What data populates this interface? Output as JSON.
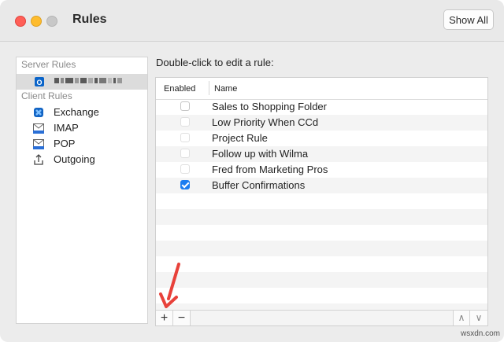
{
  "window": {
    "title": "Rules",
    "show_all_label": "Show All"
  },
  "sidebar": {
    "server_header": "Server Rules",
    "client_header": "Client Rules",
    "client_items": [
      {
        "label": "Exchange",
        "icon": "exchange-icon"
      },
      {
        "label": "IMAP",
        "icon": "imap-icon"
      },
      {
        "label": "POP",
        "icon": "pop-icon"
      },
      {
        "label": "Outgoing",
        "icon": "outgoing-icon"
      }
    ]
  },
  "main": {
    "prompt": "Double-click to edit a rule:",
    "columns": {
      "enabled": "Enabled",
      "name": "Name"
    },
    "rules": [
      {
        "name": "Sales to Shopping Folder",
        "enabled": false
      },
      {
        "name": "Low Priority When CCd",
        "enabled": false
      },
      {
        "name": "Project Rule",
        "enabled": false
      },
      {
        "name": "Follow up with Wilma",
        "enabled": false
      },
      {
        "name": "Fred from Marketing Pros",
        "enabled": false
      },
      {
        "name": "Buffer Confirmations",
        "enabled": true
      }
    ],
    "footer": {
      "add": "+",
      "remove": "−",
      "move_up": "∧",
      "move_down": "∨"
    }
  },
  "watermark": "wsxdn.com",
  "colors": {
    "accent": "#1a7cf0",
    "annotation_arrow": "#e8413a",
    "selection": "#dcdcdc"
  }
}
